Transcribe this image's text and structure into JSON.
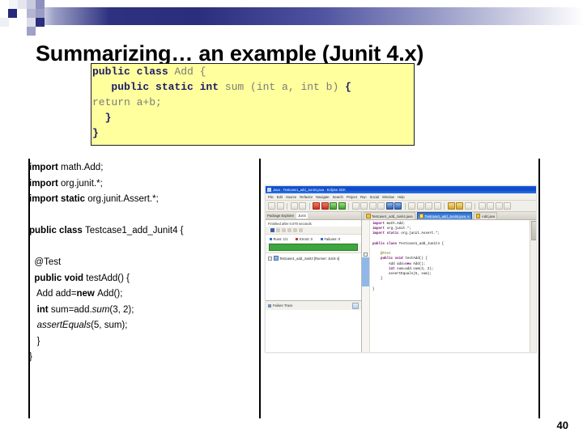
{
  "slide": {
    "title": "Summarizing… an example (Junit 4.x)",
    "page_number": "40"
  },
  "code_box": {
    "lines": [
      [
        {
          "t": "public class ",
          "s": "kw"
        },
        {
          "t": "Add {",
          "s": "pl"
        }
      ],
      [
        {
          "t": "   public static int ",
          "s": "kw"
        },
        {
          "t": "sum (int a, int b) ",
          "s": "pl"
        },
        {
          "t": "{",
          "s": "kw"
        }
      ],
      [
        {
          "t": "return a+b;",
          "s": "pl"
        }
      ],
      [
        {
          "t": "  ",
          "s": "pl"
        },
        {
          "t": "}",
          "s": "kw"
        }
      ],
      [
        {
          "t": "}",
          "s": "kw"
        }
      ]
    ]
  },
  "source_listing": {
    "lines": [
      [
        {
          "t": "import ",
          "s": "b"
        },
        {
          "t": "math.Add;",
          "s": ""
        }
      ],
      [
        {
          "t": "import ",
          "s": "b"
        },
        {
          "t": "org.junit.*;",
          "s": ""
        }
      ],
      [
        {
          "t": "import static ",
          "s": "b"
        },
        {
          "t": "org.junit.Assert.*;",
          "s": ""
        }
      ],
      [],
      [
        {
          "t": "public class ",
          "s": "b"
        },
        {
          "t": "Testcase1_add_Junit4 {",
          "s": ""
        }
      ],
      [],
      [
        {
          "t": "  @Test",
          "s": ""
        }
      ],
      [
        {
          "t": "  public void ",
          "s": "b"
        },
        {
          "t": "testAdd() {",
          "s": ""
        }
      ],
      [
        {
          "t": "   Add add=",
          "s": ""
        },
        {
          "t": "new ",
          "s": "b"
        },
        {
          "t": "Add();",
          "s": ""
        }
      ],
      [
        {
          "t": "   int ",
          "s": "b"
        },
        {
          "t": "sum=add.",
          "s": ""
        },
        {
          "t": "sum",
          "s": "i"
        },
        {
          "t": "(3, 2);",
          "s": ""
        }
      ],
      [
        {
          "t": "   ",
          "s": ""
        },
        {
          "t": "assertEquals",
          "s": "i"
        },
        {
          "t": "(5, sum);",
          "s": ""
        }
      ],
      [
        {
          "t": "   }",
          "s": ""
        }
      ],
      [
        {
          "t": "}",
          "s": ""
        }
      ]
    ]
  },
  "eclipse": {
    "window_title": "Java - Testcase1_add_Junit4.java - Eclipse SDK",
    "menus": [
      "File",
      "Edit",
      "Source",
      "Refactor",
      "Navigate",
      "Search",
      "Project",
      "Run",
      "Social",
      "Window",
      "Help"
    ],
    "left_panel": {
      "tabs": [
        "Package Explorer",
        "JUnit"
      ],
      "active_tab": "JUnit",
      "status": "Finished after 0.070 seconds",
      "counters": [
        {
          "label": "Runs:",
          "value": "1/1",
          "marker": "blue"
        },
        {
          "label": "Errors:",
          "value": "0",
          "marker": "red"
        },
        {
          "label": "Failures:",
          "value": "0",
          "marker": "blue"
        }
      ],
      "progress_color": "#3fa63f",
      "tree_row": "Testcase1_add_Junit4 [Runner: JUnit 4]",
      "failure_trace_label": "Failure Trace"
    },
    "editor": {
      "tabs": [
        {
          "label": "Testcase1_add_Junit4.java",
          "active": false,
          "closable": false
        },
        {
          "label": "Testcase1_add_Junit4.java",
          "active": true,
          "closable": true
        },
        {
          "label": "Add.java",
          "active": false,
          "closable": false
        }
      ],
      "code_lines": [
        [
          {
            "t": "import ",
            "s": "kw"
          },
          {
            "t": "math.Add;",
            "s": ""
          }
        ],
        [
          {
            "t": "import ",
            "s": "kw"
          },
          {
            "t": "org.junit.*;",
            "s": ""
          }
        ],
        [
          {
            "t": "import static ",
            "s": "kw"
          },
          {
            "t": "org.junit.Assert.*;",
            "s": ""
          }
        ],
        [],
        [
          {
            "t": "public class ",
            "s": "kw"
          },
          {
            "t": "Testcase1_add_Junit4 {",
            "s": ""
          }
        ],
        [],
        [
          {
            "t": "    @Test",
            "s": "ann"
          }
        ],
        [
          {
            "t": "    public void ",
            "s": "kw"
          },
          {
            "t": "testAdd() {",
            "s": ""
          }
        ],
        [
          {
            "t": "        Add add=",
            "s": ""
          },
          {
            "t": "new ",
            "s": "kw"
          },
          {
            "t": "Add();",
            "s": ""
          }
        ],
        [
          {
            "t": "        int ",
            "s": "kw"
          },
          {
            "t": "sum=add.sum(3, 2);",
            "s": ""
          }
        ],
        [
          {
            "t": "        assertEquals(5, sum);",
            "s": ""
          }
        ],
        [
          {
            "t": "    }",
            "s": ""
          }
        ],
        [],
        [
          {
            "t": "}",
            "s": ""
          }
        ]
      ]
    }
  },
  "colors": {
    "band_dark": "#2e3180",
    "code_bg": "#ffff9e",
    "code_keyword": "#1b1b6b",
    "code_plain": "#7a7a7a",
    "rule": "#000000"
  }
}
